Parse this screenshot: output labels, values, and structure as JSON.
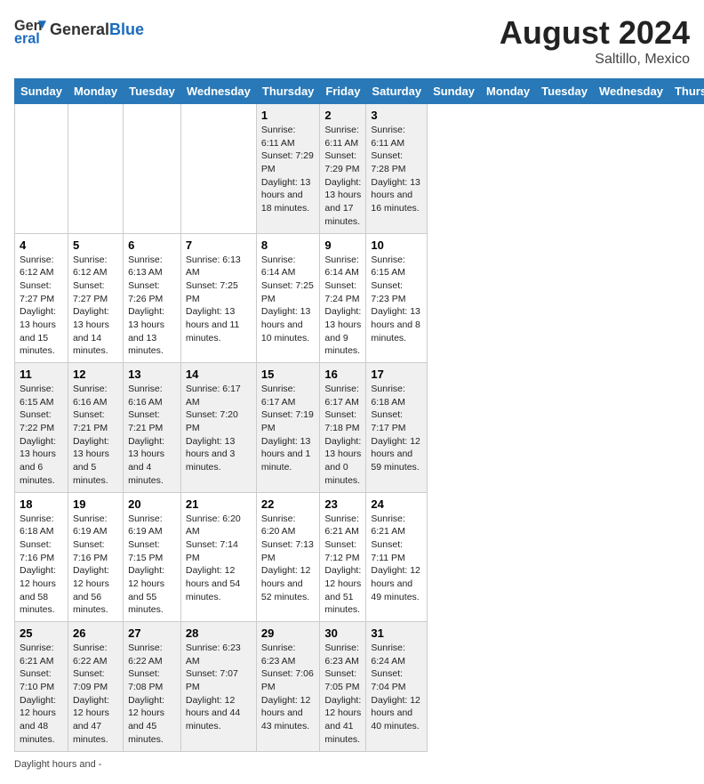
{
  "header": {
    "logo_line1": "General",
    "logo_line2": "Blue",
    "month_year": "August 2024",
    "location": "Saltillo, Mexico"
  },
  "days_of_week": [
    "Sunday",
    "Monday",
    "Tuesday",
    "Wednesday",
    "Thursday",
    "Friday",
    "Saturday"
  ],
  "weeks": [
    [
      {
        "day": "",
        "info": ""
      },
      {
        "day": "",
        "info": ""
      },
      {
        "day": "",
        "info": ""
      },
      {
        "day": "",
        "info": ""
      },
      {
        "day": "1",
        "info": "Sunrise: 6:11 AM\nSunset: 7:29 PM\nDaylight: 13 hours and 18 minutes."
      },
      {
        "day": "2",
        "info": "Sunrise: 6:11 AM\nSunset: 7:29 PM\nDaylight: 13 hours and 17 minutes."
      },
      {
        "day": "3",
        "info": "Sunrise: 6:11 AM\nSunset: 7:28 PM\nDaylight: 13 hours and 16 minutes."
      }
    ],
    [
      {
        "day": "4",
        "info": "Sunrise: 6:12 AM\nSunset: 7:27 PM\nDaylight: 13 hours and 15 minutes."
      },
      {
        "day": "5",
        "info": "Sunrise: 6:12 AM\nSunset: 7:27 PM\nDaylight: 13 hours and 14 minutes."
      },
      {
        "day": "6",
        "info": "Sunrise: 6:13 AM\nSunset: 7:26 PM\nDaylight: 13 hours and 13 minutes."
      },
      {
        "day": "7",
        "info": "Sunrise: 6:13 AM\nSunset: 7:25 PM\nDaylight: 13 hours and 11 minutes."
      },
      {
        "day": "8",
        "info": "Sunrise: 6:14 AM\nSunset: 7:25 PM\nDaylight: 13 hours and 10 minutes."
      },
      {
        "day": "9",
        "info": "Sunrise: 6:14 AM\nSunset: 7:24 PM\nDaylight: 13 hours and 9 minutes."
      },
      {
        "day": "10",
        "info": "Sunrise: 6:15 AM\nSunset: 7:23 PM\nDaylight: 13 hours and 8 minutes."
      }
    ],
    [
      {
        "day": "11",
        "info": "Sunrise: 6:15 AM\nSunset: 7:22 PM\nDaylight: 13 hours and 6 minutes."
      },
      {
        "day": "12",
        "info": "Sunrise: 6:16 AM\nSunset: 7:21 PM\nDaylight: 13 hours and 5 minutes."
      },
      {
        "day": "13",
        "info": "Sunrise: 6:16 AM\nSunset: 7:21 PM\nDaylight: 13 hours and 4 minutes."
      },
      {
        "day": "14",
        "info": "Sunrise: 6:17 AM\nSunset: 7:20 PM\nDaylight: 13 hours and 3 minutes."
      },
      {
        "day": "15",
        "info": "Sunrise: 6:17 AM\nSunset: 7:19 PM\nDaylight: 13 hours and 1 minute."
      },
      {
        "day": "16",
        "info": "Sunrise: 6:17 AM\nSunset: 7:18 PM\nDaylight: 13 hours and 0 minutes."
      },
      {
        "day": "17",
        "info": "Sunrise: 6:18 AM\nSunset: 7:17 PM\nDaylight: 12 hours and 59 minutes."
      }
    ],
    [
      {
        "day": "18",
        "info": "Sunrise: 6:18 AM\nSunset: 7:16 PM\nDaylight: 12 hours and 58 minutes."
      },
      {
        "day": "19",
        "info": "Sunrise: 6:19 AM\nSunset: 7:16 PM\nDaylight: 12 hours and 56 minutes."
      },
      {
        "day": "20",
        "info": "Sunrise: 6:19 AM\nSunset: 7:15 PM\nDaylight: 12 hours and 55 minutes."
      },
      {
        "day": "21",
        "info": "Sunrise: 6:20 AM\nSunset: 7:14 PM\nDaylight: 12 hours and 54 minutes."
      },
      {
        "day": "22",
        "info": "Sunrise: 6:20 AM\nSunset: 7:13 PM\nDaylight: 12 hours and 52 minutes."
      },
      {
        "day": "23",
        "info": "Sunrise: 6:21 AM\nSunset: 7:12 PM\nDaylight: 12 hours and 51 minutes."
      },
      {
        "day": "24",
        "info": "Sunrise: 6:21 AM\nSunset: 7:11 PM\nDaylight: 12 hours and 49 minutes."
      }
    ],
    [
      {
        "day": "25",
        "info": "Sunrise: 6:21 AM\nSunset: 7:10 PM\nDaylight: 12 hours and 48 minutes."
      },
      {
        "day": "26",
        "info": "Sunrise: 6:22 AM\nSunset: 7:09 PM\nDaylight: 12 hours and 47 minutes."
      },
      {
        "day": "27",
        "info": "Sunrise: 6:22 AM\nSunset: 7:08 PM\nDaylight: 12 hours and 45 minutes."
      },
      {
        "day": "28",
        "info": "Sunrise: 6:23 AM\nSunset: 7:07 PM\nDaylight: 12 hours and 44 minutes."
      },
      {
        "day": "29",
        "info": "Sunrise: 6:23 AM\nSunset: 7:06 PM\nDaylight: 12 hours and 43 minutes."
      },
      {
        "day": "30",
        "info": "Sunrise: 6:23 AM\nSunset: 7:05 PM\nDaylight: 12 hours and 41 minutes."
      },
      {
        "day": "31",
        "info": "Sunrise: 6:24 AM\nSunset: 7:04 PM\nDaylight: 12 hours and 40 minutes."
      }
    ]
  ],
  "footer": {
    "line1": "Daylight hours",
    "line2": "and -"
  }
}
